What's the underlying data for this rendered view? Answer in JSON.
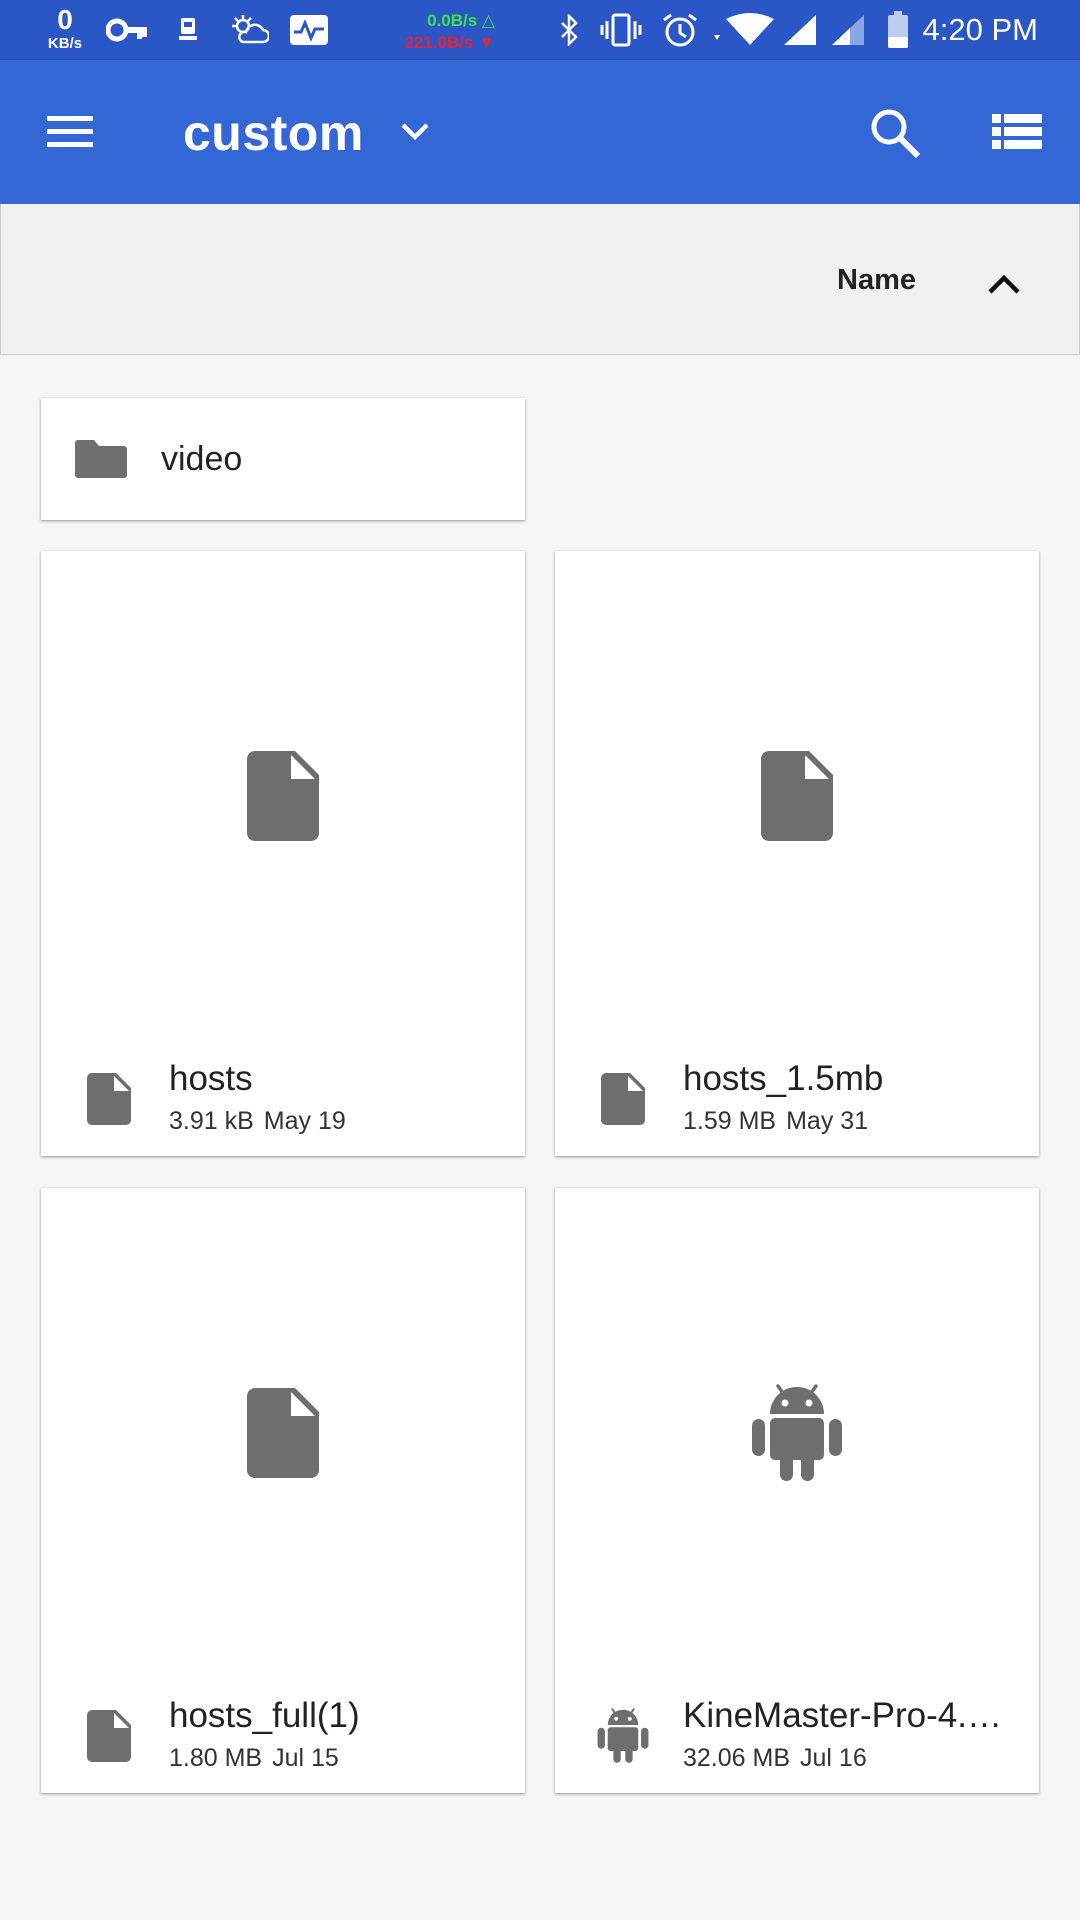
{
  "status_bar": {
    "speed_value": "0",
    "speed_unit": "KB/s",
    "upload_rate": "0.0B/s △",
    "download_rate": "221.0B/s ▼",
    "time": "4:20 PM",
    "icons": [
      "key-icon",
      "usb-debug-icon",
      "weather-icon",
      "activity-monitor-icon",
      "bluetooth-icon",
      "vibrate-icon",
      "alarm-icon",
      "wifi-icon",
      "signal-icon",
      "signal-2-icon",
      "battery-icon"
    ]
  },
  "app_bar": {
    "title": "custom",
    "background": "#3367d6",
    "icons": [
      "menu-icon",
      "chevron-down-icon",
      "search-icon",
      "list-view-icon"
    ]
  },
  "sort_bar": {
    "label": "Name",
    "direction_icon": "chevron-up-icon"
  },
  "folders": [
    {
      "name": "video",
      "icon": "folder-icon"
    }
  ],
  "files": [
    {
      "name": "hosts",
      "size": "3.91 kB",
      "date": "May 19",
      "icon": "file-icon"
    },
    {
      "name": "hosts_1.5mb",
      "size": "1.59 MB",
      "date": "May 31",
      "icon": "file-icon"
    },
    {
      "name": "hosts_full(1)",
      "size": "1.80 MB",
      "date": "Jul 15",
      "icon": "file-icon"
    },
    {
      "name": "KineMaster-Pro-4.2…",
      "size": "32.06 MB",
      "date": "Jul 16",
      "icon": "android-icon"
    }
  ]
}
